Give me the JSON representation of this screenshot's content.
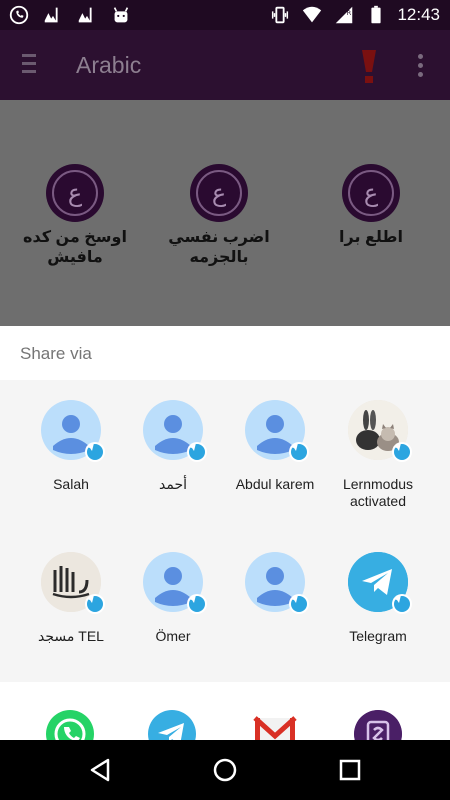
{
  "status_bar": {
    "time": "12:43",
    "left_icons": [
      "whatsapp-icon",
      "image-icon",
      "image-icon",
      "android-icon"
    ],
    "right_icons": [
      "vibrate-icon",
      "wifi-icon",
      "signal-icon",
      "battery-icon"
    ]
  },
  "app_bar": {
    "title": "Arabic",
    "accent": "#2c1030"
  },
  "background_tiles": [
    {
      "label": "اوسخ من كده مافيش"
    },
    {
      "label": "اضرب نفسي بالجزمه"
    },
    {
      "label": "اطلع برا"
    }
  ],
  "share_sheet": {
    "title": "Share via",
    "contacts": [
      {
        "name": "Salah",
        "avatar": "default"
      },
      {
        "name": "أحمد",
        "avatar": "default"
      },
      {
        "name": "Abdul karem",
        "avatar": "default"
      },
      {
        "name": "Lernmodus activated",
        "avatar": "photo-rabbit-cat"
      },
      {
        "name": "مسجد TEL",
        "avatar": "photo-calligraphy"
      },
      {
        "name": "Ömer",
        "avatar": "default"
      },
      {
        "name": "",
        "avatar": "default"
      },
      {
        "name": "Telegram",
        "avatar": "telegram-logo"
      }
    ],
    "apps": [
      "whatsapp-icon",
      "telegram-icon",
      "gmail-icon",
      "app-icon"
    ]
  },
  "nav_bar": {
    "buttons": [
      "back-icon",
      "home-icon",
      "recents-icon"
    ]
  }
}
